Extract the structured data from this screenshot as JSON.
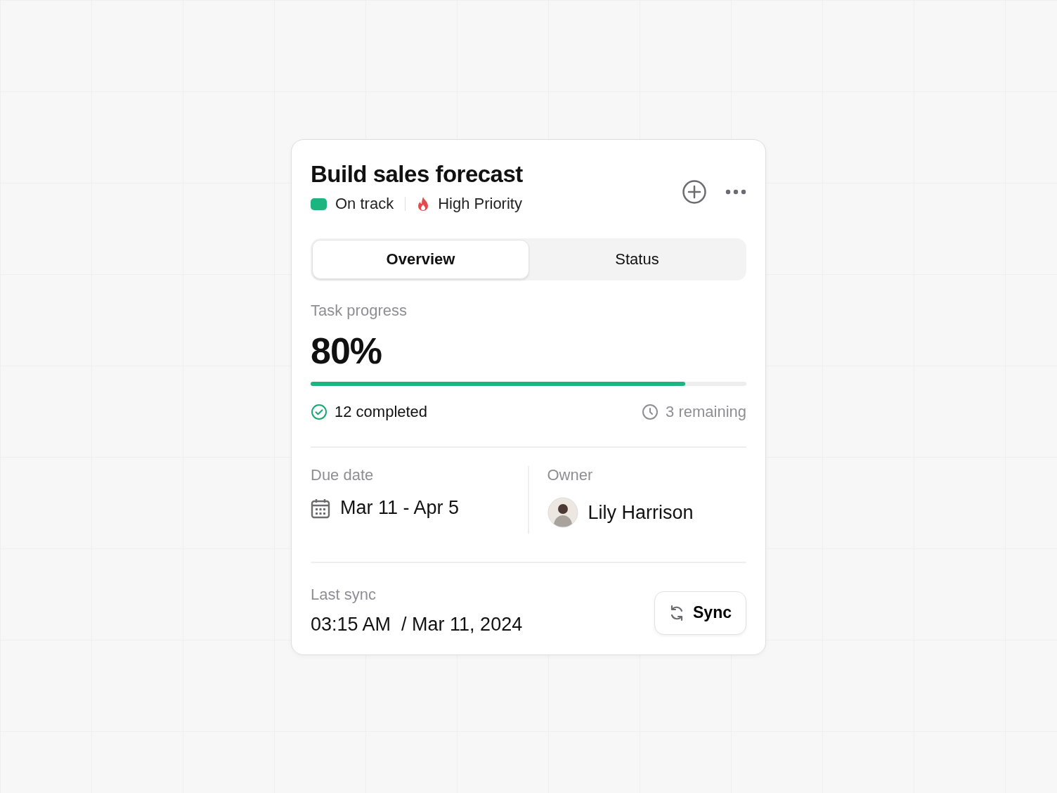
{
  "card": {
    "title": "Build sales forecast",
    "status": {
      "label": "On track"
    },
    "priority": {
      "label": "High Priority"
    },
    "tabs": [
      {
        "label": "Overview",
        "selected": true
      },
      {
        "label": "Status",
        "selected": false
      }
    ],
    "progress": {
      "label": "Task progress",
      "value": "80%",
      "level": 0.86,
      "completed": "12 completed",
      "remaining": "3 remaining"
    },
    "due_date": {
      "label": "Due date",
      "value": "Mar 11 - Apr 5"
    },
    "owner": {
      "label": "Owner",
      "name": "Lily Harrison"
    },
    "last_sync": {
      "label": "Last sync",
      "value": "03:15 AM  / Mar 11, 2024"
    },
    "sync_button": "Sync"
  }
}
